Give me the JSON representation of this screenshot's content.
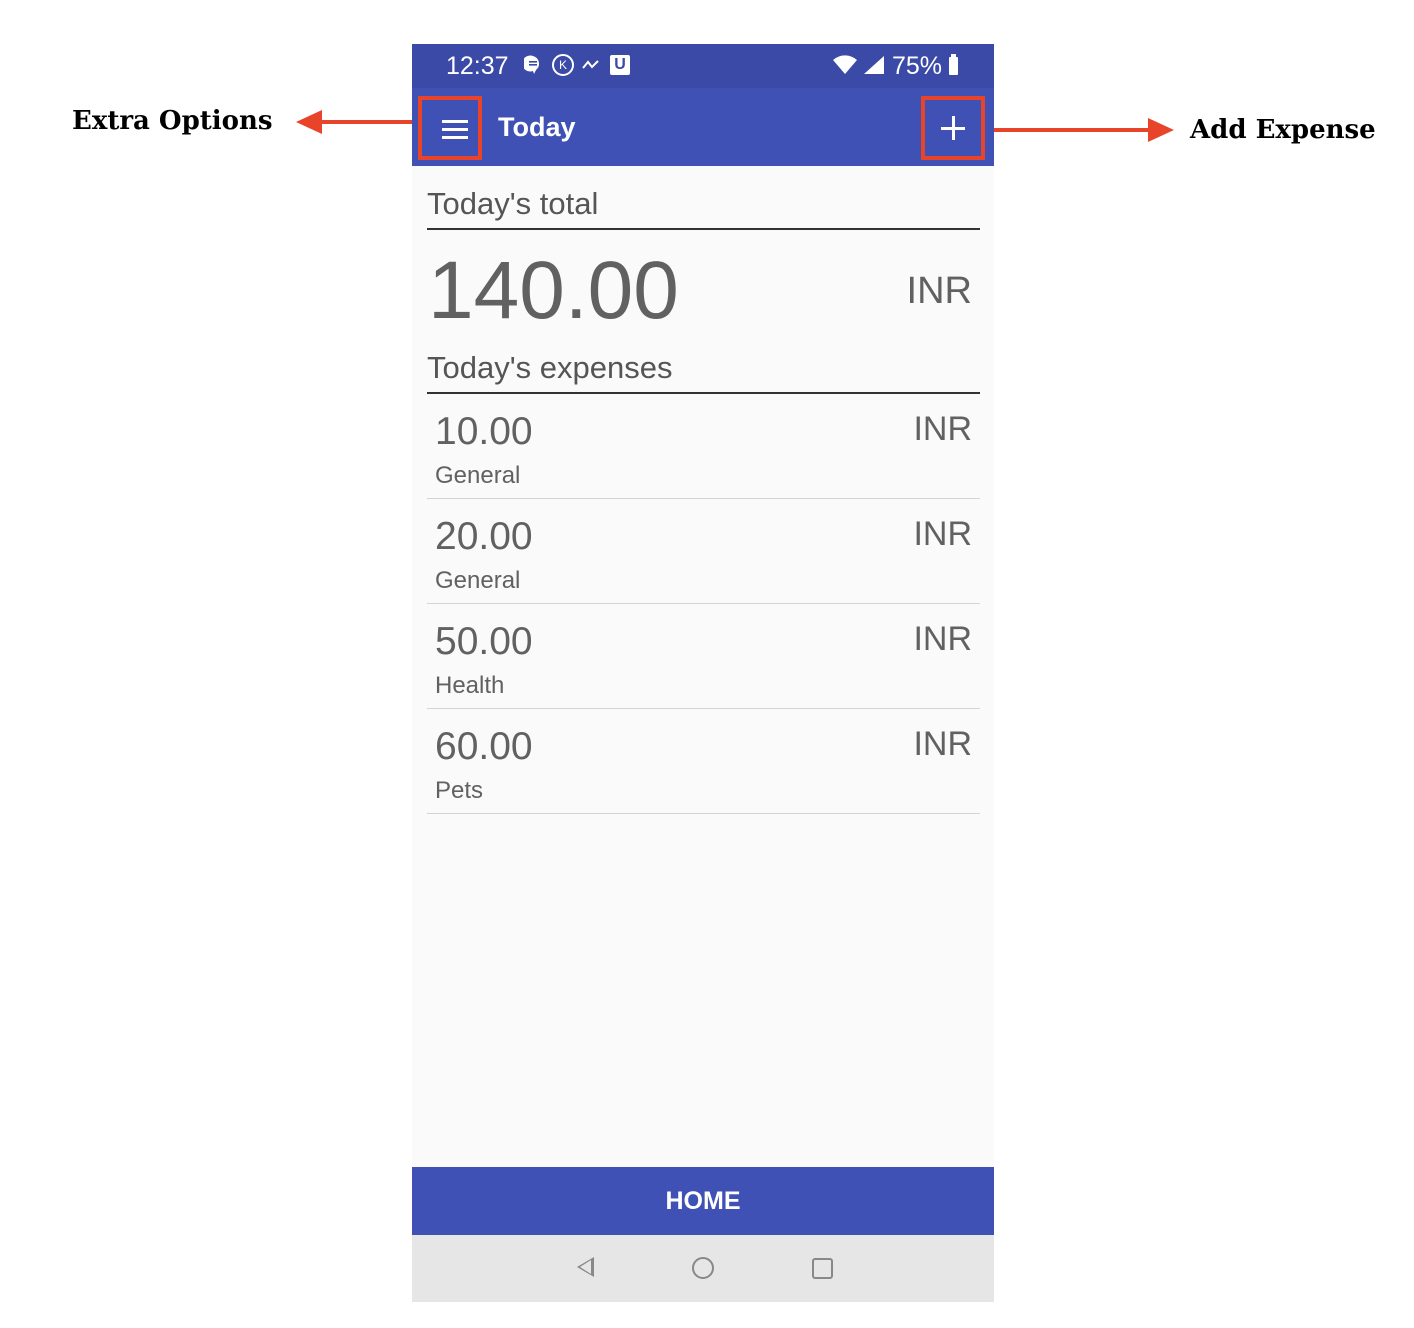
{
  "annotations": {
    "left_label": "Extra Options",
    "right_label": "Add Expense",
    "arrow_color": "#e8442a"
  },
  "status_bar": {
    "time": "12:37",
    "battery": "75%",
    "icons": [
      "message-icon",
      "k-icon",
      "wave-icon",
      "u-icon",
      "wifi-icon",
      "signal-icon",
      "battery-icon"
    ]
  },
  "app_bar": {
    "title": "Today",
    "menu_icon": "hamburger-menu-icon",
    "add_icon": "plus-icon",
    "color": "#3f51b5"
  },
  "total": {
    "header": "Today's total",
    "amount": "140.00",
    "currency": "INR"
  },
  "expenses": {
    "header": "Today's expenses",
    "items": [
      {
        "amount": "10.00",
        "currency": "INR",
        "category": "General"
      },
      {
        "amount": "20.00",
        "currency": "INR",
        "category": "General"
      },
      {
        "amount": "50.00",
        "currency": "INR",
        "category": "Health"
      },
      {
        "amount": "60.00",
        "currency": "INR",
        "category": "Pets"
      }
    ]
  },
  "bottom_nav": {
    "home_label": "HOME"
  },
  "system_nav": {
    "buttons": [
      "back-icon",
      "home-icon",
      "recents-icon"
    ]
  }
}
